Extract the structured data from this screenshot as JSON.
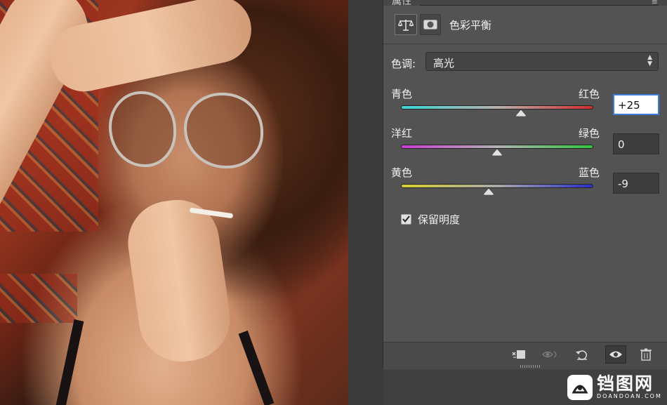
{
  "panel": {
    "title": "属性",
    "adjustment_name": "色彩平衡",
    "icons": {
      "adjustment": "balance-scale-icon",
      "mask": "layer-mask-icon"
    }
  },
  "tone": {
    "label": "色调:",
    "value": "高光"
  },
  "sliders": [
    {
      "left": "青色",
      "right": "红色",
      "value": "+25",
      "level": 25,
      "colors": [
        "#39d6d8",
        "#cf2d2d"
      ]
    },
    {
      "left": "洋红",
      "right": "绿色",
      "value": "0",
      "level": 0,
      "colors": [
        "#cc3cd6",
        "#2fc73c"
      ]
    },
    {
      "left": "黄色",
      "right": "蓝色",
      "value": "-9",
      "level": -9,
      "colors": [
        "#d7cf2e",
        "#2a2fc7"
      ]
    }
  ],
  "preserve_luminosity": {
    "label": "保留明度",
    "checked": true
  },
  "bottom_bar": {
    "icons": [
      "clip-to-layer-icon",
      "view-previous-state-icon",
      "reset-icon",
      "toggle-visibility-icon",
      "trash-icon"
    ]
  },
  "watermark": {
    "cn": "铛图网",
    "en": "DOANDOAN.COM"
  },
  "colors": {
    "panel_bg": "#535353",
    "accent_focus": "#3d7bd8"
  }
}
